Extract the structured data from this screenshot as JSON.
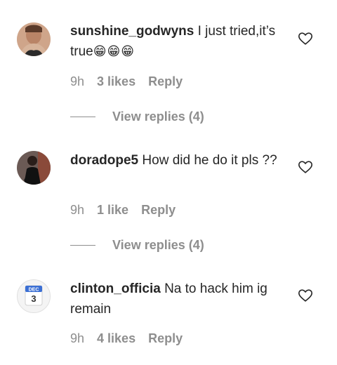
{
  "comments": [
    {
      "username": "sunshine_godwyns",
      "text": "I just tried,it’s true",
      "emoji": "😁😁😁",
      "time": "9h",
      "likes": "3 likes",
      "reply": "Reply",
      "view_replies": "View replies (4)"
    },
    {
      "username": "doradope5",
      "text": "How did he do it pls ??",
      "time": "9h",
      "likes": "1 like",
      "reply": "Reply",
      "view_replies": "View replies (4)"
    },
    {
      "username": "clinton_officia",
      "text": "Na to hack him ig remain",
      "time": "9h",
      "likes": "4 likes",
      "reply": "Reply"
    }
  ],
  "calendar_avatar": {
    "month": "DEC",
    "day": "3"
  }
}
